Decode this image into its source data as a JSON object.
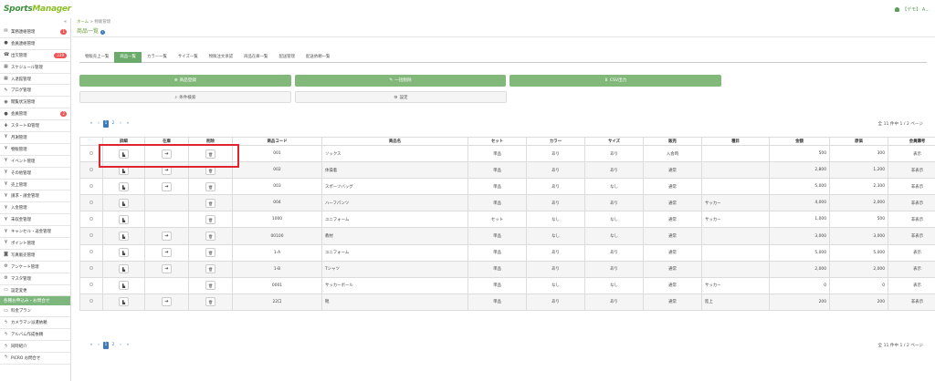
{
  "app": {
    "logo_part1": "Sports",
    "logo_part2": "Manager",
    "user_label": "【デモ】 A..."
  },
  "sidebar": {
    "collapse_glyph": "«",
    "items": [
      {
        "label": "業務連絡管理",
        "icon": "envelope-icon",
        "glyph": "✉",
        "badge": "1"
      },
      {
        "label": "会員連絡管理",
        "icon": "chat-icon",
        "glyph": "●",
        "badge": ""
      },
      {
        "label": "出欠管理",
        "icon": "phone-icon",
        "glyph": "☎",
        "badge": "239"
      },
      {
        "label": "スケジュール管理",
        "icon": "calendar-icon",
        "glyph": "▦",
        "badge": ""
      },
      {
        "label": "入退館管理",
        "icon": "calendar-icon",
        "glyph": "▦",
        "badge": ""
      },
      {
        "label": "ブログ管理",
        "icon": "pencil-icon",
        "glyph": "✎",
        "badge": ""
      },
      {
        "label": "閲覧状況管理",
        "icon": "eye-icon",
        "glyph": "◉",
        "badge": ""
      },
      {
        "label": "会員管理",
        "icon": "user-icon",
        "glyph": "●",
        "badge": "2"
      },
      {
        "label": "スタートID管理",
        "icon": "user-plus-icon",
        "glyph": "✚",
        "badge": ""
      },
      {
        "label": "月謝管理",
        "icon": "yen-icon",
        "glyph": "¥",
        "badge": ""
      },
      {
        "label": "物販管理",
        "icon": "yen-icon",
        "glyph": "¥",
        "badge": ""
      },
      {
        "label": "イベント管理",
        "icon": "yen-icon",
        "glyph": "¥",
        "badge": ""
      },
      {
        "label": "その他管理",
        "icon": "yen-icon",
        "glyph": "¥",
        "badge": ""
      },
      {
        "label": "売上管理",
        "icon": "yen-icon",
        "glyph": "¥",
        "badge": ""
      },
      {
        "label": "請求・請金管理",
        "icon": "yen-icon",
        "glyph": "¥",
        "badge": ""
      },
      {
        "label": "入金管理",
        "icon": "yen-icon",
        "glyph": "¥",
        "badge": ""
      },
      {
        "label": "未収金管理",
        "icon": "yen-icon",
        "glyph": "¥",
        "badge": ""
      },
      {
        "label": "キャンセル・返金管理",
        "icon": "yen-icon",
        "glyph": "¥",
        "badge": ""
      },
      {
        "label": "ポイント管理",
        "icon": "yen-icon",
        "glyph": "¥",
        "badge": ""
      },
      {
        "label": "写真販売管理",
        "icon": "camera-icon",
        "glyph": "◙",
        "badge": ""
      },
      {
        "label": "アンケート管理",
        "icon": "gear-icon",
        "glyph": "⚙",
        "badge": ""
      },
      {
        "label": "マスタ管理",
        "icon": "gear-icon",
        "glyph": "⚙",
        "badge": ""
      },
      {
        "label": "設定変更",
        "icon": "monitor-icon",
        "glyph": "▭",
        "badge": ""
      }
    ],
    "section_label": "各種お申込み・お問合せ",
    "section_items": [
      {
        "label": "料金プラン",
        "icon": "monitor-icon",
        "glyph": "▭"
      },
      {
        "label": "カメラマン派遣依頼",
        "icon": "bolt-icon",
        "glyph": "ϟ"
      },
      {
        "label": "アルバム作成依頼",
        "icon": "bolt-icon",
        "glyph": "ϟ"
      },
      {
        "label": "同時紹介",
        "icon": "bolt-icon",
        "glyph": "ϟ"
      },
      {
        "label": "PiCRO お問合せ",
        "icon": "bolt-icon",
        "glyph": "ϟ"
      }
    ]
  },
  "breadcrumb": {
    "home": "ホーム",
    "sep": " > ",
    "current": "物販管理"
  },
  "page": {
    "title": "商品一覧",
    "info_glyph": "i"
  },
  "tabs": [
    {
      "label": "物販売上一覧",
      "active": false
    },
    {
      "label": "商品一覧",
      "active": true
    },
    {
      "label": "カラー一覧",
      "active": false
    },
    {
      "label": "サイズ一覧",
      "active": false
    },
    {
      "label": "物販注文承認",
      "active": false
    },
    {
      "label": "商品在庫一覧",
      "active": false
    },
    {
      "label": "配送管理",
      "active": false
    },
    {
      "label": "配送依頼一覧",
      "active": false
    }
  ],
  "buttons": {
    "register": "商品登録",
    "bulk_delete": "一括削除",
    "csv": "CSV出力",
    "search": "条件検索",
    "settings": "設定"
  },
  "pagination": {
    "first": "«",
    "prev": "‹",
    "pages": [
      "1",
      "2"
    ],
    "current": "1",
    "next": "›",
    "last": "»",
    "count": "全 11 件中 1 / 2 ページ"
  },
  "table": {
    "headers": [
      "",
      "詳細",
      "在庫",
      "削除",
      "商品コード",
      "商品名",
      "セット",
      "カラー",
      "サイズ",
      "販売",
      "種目",
      "金額",
      "原価",
      "会員購考"
    ],
    "rows": [
      {
        "code": "001",
        "name": "ソックス",
        "set": "単品",
        "color": "あり",
        "size": "あり",
        "sale": "入会時",
        "event": "",
        "price": "500",
        "cost": "300",
        "visible": "表示",
        "stock": true
      },
      {
        "code": "002",
        "name": "体操着",
        "set": "単品",
        "color": "あり",
        "size": "あり",
        "sale": "通常",
        "event": "",
        "price": "2,800",
        "cost": "1,200",
        "visible": "非表示",
        "stock": true
      },
      {
        "code": "003",
        "name": "スポーツバッグ",
        "set": "単品",
        "color": "あり",
        "size": "なし",
        "sale": "通常",
        "event": "",
        "price": "5,000",
        "cost": "2,300",
        "visible": "非表示",
        "stock": true
      },
      {
        "code": "004",
        "name": "ハーフパンツ",
        "set": "単品",
        "color": "あり",
        "size": "あり",
        "sale": "通常",
        "event": "サッカー",
        "price": "4,000",
        "cost": "2,000",
        "visible": "非表示",
        "stock": false
      },
      {
        "code": "1000",
        "name": "ユニフォーム",
        "set": "セット",
        "color": "なし",
        "size": "なし",
        "sale": "通常",
        "event": "サッカー",
        "price": "1,000",
        "cost": "500",
        "visible": "非表示",
        "stock": false
      },
      {
        "code": "00100",
        "name": "教材",
        "set": "単品",
        "color": "なし",
        "size": "なし",
        "sale": "通常",
        "event": "",
        "price": "3,000",
        "cost": "3,000",
        "visible": "非表示",
        "stock": true
      },
      {
        "code": "1-A",
        "name": "ユニフォーム",
        "set": "単品",
        "color": "あり",
        "size": "あり",
        "sale": "通常",
        "event": "",
        "price": "5,000",
        "cost": "5,000",
        "visible": "表示",
        "stock": true
      },
      {
        "code": "1-B",
        "name": "Tシャツ",
        "set": "単品",
        "color": "あり",
        "size": "あり",
        "sale": "通常",
        "event": "",
        "price": "2,000",
        "cost": "2,000",
        "visible": "表示",
        "stock": true
      },
      {
        "code": "0001",
        "name": "サッカーボール",
        "set": "単品",
        "color": "なし",
        "size": "なし",
        "sale": "通常",
        "event": "サッカー",
        "price": "0",
        "cost": "0",
        "visible": "表示",
        "stock": false
      },
      {
        "code": "22口",
        "name": "靴",
        "set": "単品",
        "color": "あり",
        "size": "あり",
        "sale": "通常",
        "event": "陸上",
        "price": "200",
        "cost": "200",
        "visible": "非表示",
        "stock": true
      }
    ]
  },
  "icons": {
    "detail": "file-icon",
    "stock": "arrow-right-icon",
    "delete": "trash-icon"
  },
  "colors": {
    "brand": "#3c8f3c",
    "accent": "#83b87b",
    "highlight": "#e0242f",
    "link": "#3a7abd"
  }
}
